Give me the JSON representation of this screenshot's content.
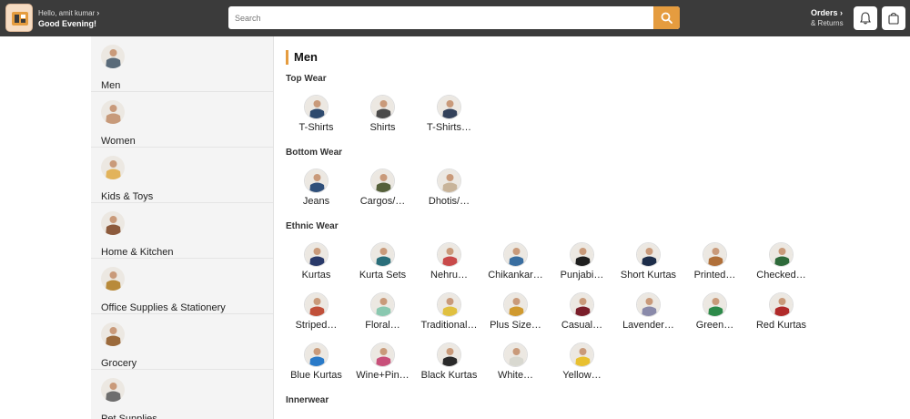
{
  "header": {
    "greeting": "Hello, amit kumar",
    "greeting_chevron": "›",
    "subgreeting": "Good Evening!",
    "search_placeholder": "Search",
    "orders_label": "Orders ›",
    "returns_label": "& Returns",
    "brand_color": "#e59c3f",
    "bar_color": "#3b3b3b"
  },
  "sidebar": {
    "items": [
      {
        "label": "Men",
        "avatar": "#5a6b7a"
      },
      {
        "label": "Women",
        "avatar": "#c79a7a"
      },
      {
        "label": "Kids & Toys",
        "avatar": "#e2b35a"
      },
      {
        "label": "Home & Kitchen",
        "avatar": "#8c5a3c"
      },
      {
        "label": "Office Supplies & Stationery",
        "avatar": "#b88a3a"
      },
      {
        "label": "Grocery",
        "avatar": "#9b6a3c"
      },
      {
        "label": "Pet Supplies",
        "avatar": "#6e6e6e"
      }
    ]
  },
  "main": {
    "title": "Men",
    "sections": [
      {
        "title": "Top Wear",
        "items": [
          {
            "label": "T-Shirts",
            "color": "#2e4a6e"
          },
          {
            "label": "Shirts",
            "color": "#4a4a4a"
          },
          {
            "label": "T-Shirts…",
            "color": "#33415a"
          }
        ]
      },
      {
        "title": "Bottom Wear",
        "items": [
          {
            "label": "Jeans",
            "color": "#2f4f7a"
          },
          {
            "label": "Cargos/…",
            "color": "#55603a"
          },
          {
            "label": "Dhotis/…",
            "color": "#c8b49a"
          }
        ]
      },
      {
        "title": "Ethnic Wear",
        "items": [
          {
            "label": "Kurtas",
            "color": "#2a3a6a"
          },
          {
            "label": "Kurta Sets",
            "color": "#2a6e7a"
          },
          {
            "label": "Nehru…",
            "color": "#c84a4a"
          },
          {
            "label": "Chikankar…",
            "color": "#3a6ea0"
          },
          {
            "label": "Punjabi…",
            "color": "#1f1f1f"
          },
          {
            "label": "Short Kurtas",
            "color": "#1e2e4a"
          },
          {
            "label": "Printed…",
            "color": "#b0703a"
          },
          {
            "label": "Checked…",
            "color": "#2e6a3a"
          },
          {
            "label": "Striped…",
            "color": "#c0503a"
          },
          {
            "label": "Floral…",
            "color": "#8ac8b0"
          },
          {
            "label": "Traditional…",
            "color": "#e0c040"
          },
          {
            "label": "Plus Size…",
            "color": "#d09a30"
          },
          {
            "label": "Casual…",
            "color": "#7a1e2a"
          },
          {
            "label": "Lavender…",
            "color": "#8a8aaa"
          },
          {
            "label": "Green…",
            "color": "#2e8a4a"
          },
          {
            "label": "Red Kurtas",
            "color": "#b02a2a"
          },
          {
            "label": "Blue Kurtas",
            "color": "#2a7ac8"
          },
          {
            "label": "Wine+Pin…",
            "color": "#c8507a"
          },
          {
            "label": "Black Kurtas",
            "color": "#2a2a2a"
          },
          {
            "label": "White…",
            "color": "#d8d8d0"
          },
          {
            "label": "Yellow…",
            "color": "#e8c030"
          }
        ]
      },
      {
        "title": "Innerwear",
        "items": []
      }
    ]
  }
}
